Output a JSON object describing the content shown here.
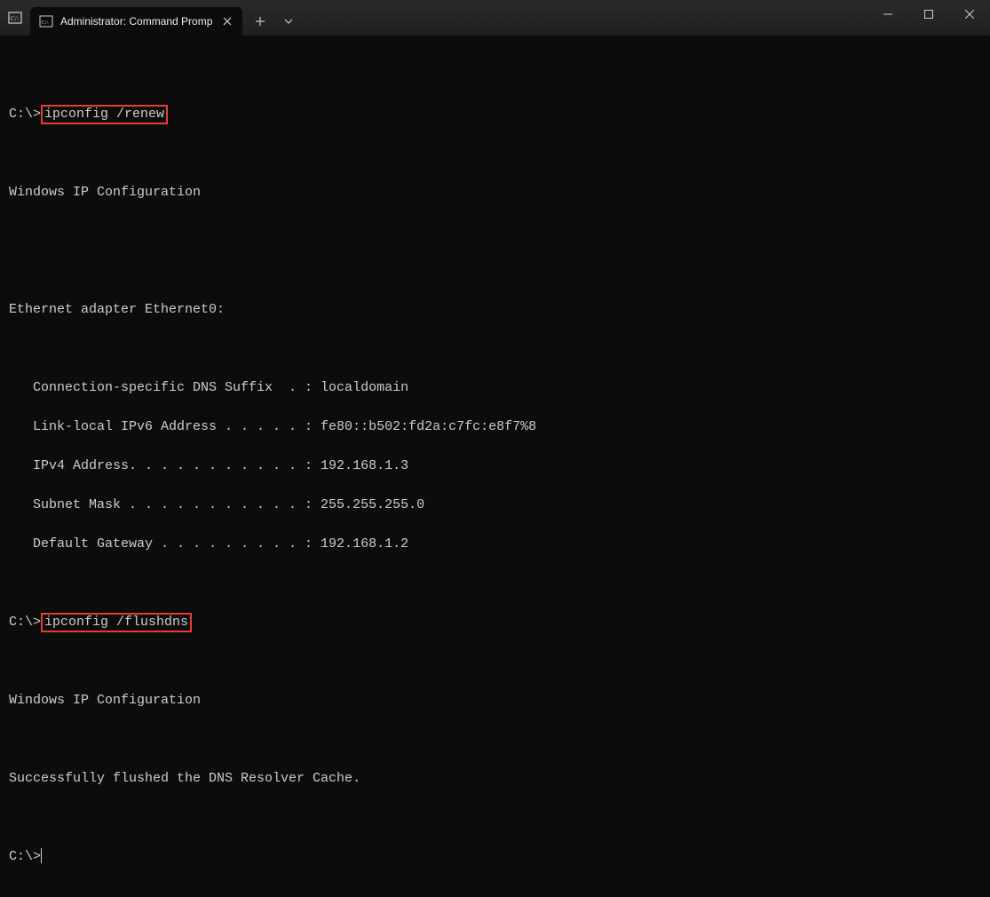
{
  "window": {
    "tab_title": "Administrator: Command Promp",
    "sys_icon": "C:\\"
  },
  "terminal": {
    "prompt1_path": "C:\\>",
    "cmd1": "ipconfig /renew",
    "heading1": "Windows IP Configuration",
    "adapter_header": "Ethernet adapter Ethernet0:",
    "line_dns": "   Connection-specific DNS Suffix  . : localdomain",
    "line_ipv6": "   Link-local IPv6 Address . . . . . : fe80::b502:fd2a:c7fc:e8f7%8",
    "line_ipv4": "   IPv4 Address. . . . . . . . . . . : 192.168.1.3",
    "line_subnet": "   Subnet Mask . . . . . . . . . . . : 255.255.255.0",
    "line_gateway": "   Default Gateway . . . . . . . . . : 192.168.1.2",
    "prompt2_path": "C:\\>",
    "cmd2": "ipconfig /flushdns",
    "heading2": "Windows IP Configuration",
    "success_msg": "Successfully flushed the DNS Resolver Cache.",
    "prompt3_path": "C:\\>"
  }
}
